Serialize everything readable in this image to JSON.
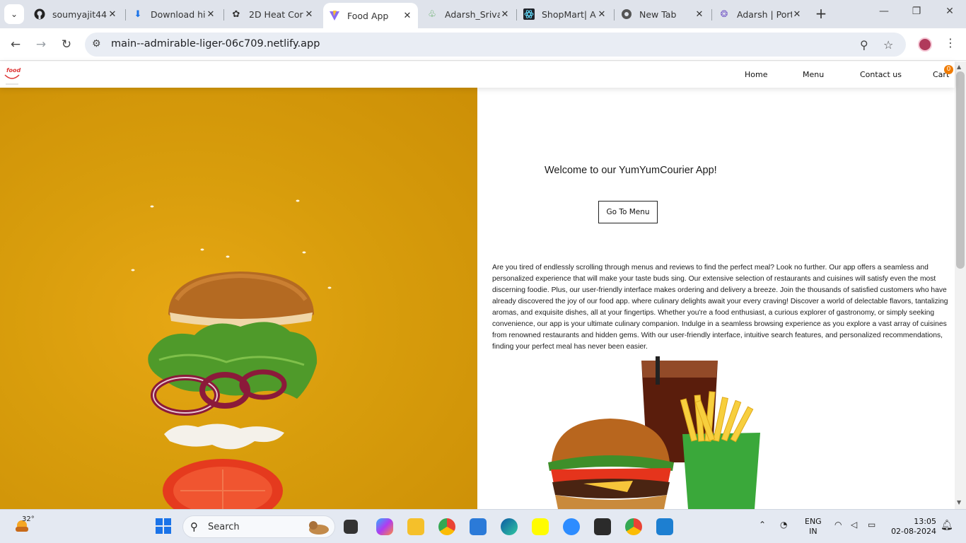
{
  "browser": {
    "tabs": [
      {
        "label": "soumyajit44",
        "icon": "github-icon"
      },
      {
        "label": "Download hi",
        "icon": "download-icon"
      },
      {
        "label": "2D Heat Cor",
        "icon": "openai-icon"
      },
      {
        "label": "Food App",
        "icon": "vite-icon",
        "active": true
      },
      {
        "label": "Adarsh_Sriva",
        "icon": "leaf-icon"
      },
      {
        "label": "ShopMart| A",
        "icon": "react-icon"
      },
      {
        "label": "New Tab",
        "icon": "chrome-icon"
      },
      {
        "label": "Adarsh | Port",
        "icon": "portfolio-icon"
      }
    ],
    "url": "main--admirable-liger-06c709.netlify.app"
  },
  "site": {
    "logo_text": "food",
    "nav": {
      "home": "Home",
      "menu": "Menu",
      "contact": "Contact us",
      "cart": "Cart",
      "cart_count": "0"
    },
    "welcome": "Welcome to our YumYumCourier App!",
    "cta": "Go To Menu",
    "paragraph": "Are you tired of endlessly scrolling through menus and reviews to find the perfect meal? Look no further. Our app offers a seamless and personalized experience that will make your taste buds sing. Our extensive selection of restaurants and cuisines will satisfy even the most discerning foodie. Plus, our user-friendly interface makes ordering and delivery a breeze. Join the thousands of satisfied customers who have already discovered the joy of our food app. where culinary delights await your every craving! Discover a world of delectable flavors, tantalizing aromas, and exquisite dishes, all at your fingertips. Whether you're a food enthusiast, a curious explorer of gastronomy, or simply seeking convenience, our app is your ultimate culinary companion. Indulge in a seamless browsing experience as you explore a vast array of cuisines from renowned restaurants and hidden gems. With our user-friendly interface, intuitive search features, and personalized recommendations, finding your perfect meal has never been easier."
  },
  "taskbar": {
    "weather_temp": "32°",
    "search_placeholder": "Search",
    "lang_top": "ENG",
    "lang_bottom": "IN",
    "time": "13:05",
    "date": "02-08-2024"
  },
  "colors": {
    "hero_bg": "#d99e0c",
    "cart_badge": "#f07b00",
    "accent_blue": "#1a73e8"
  }
}
